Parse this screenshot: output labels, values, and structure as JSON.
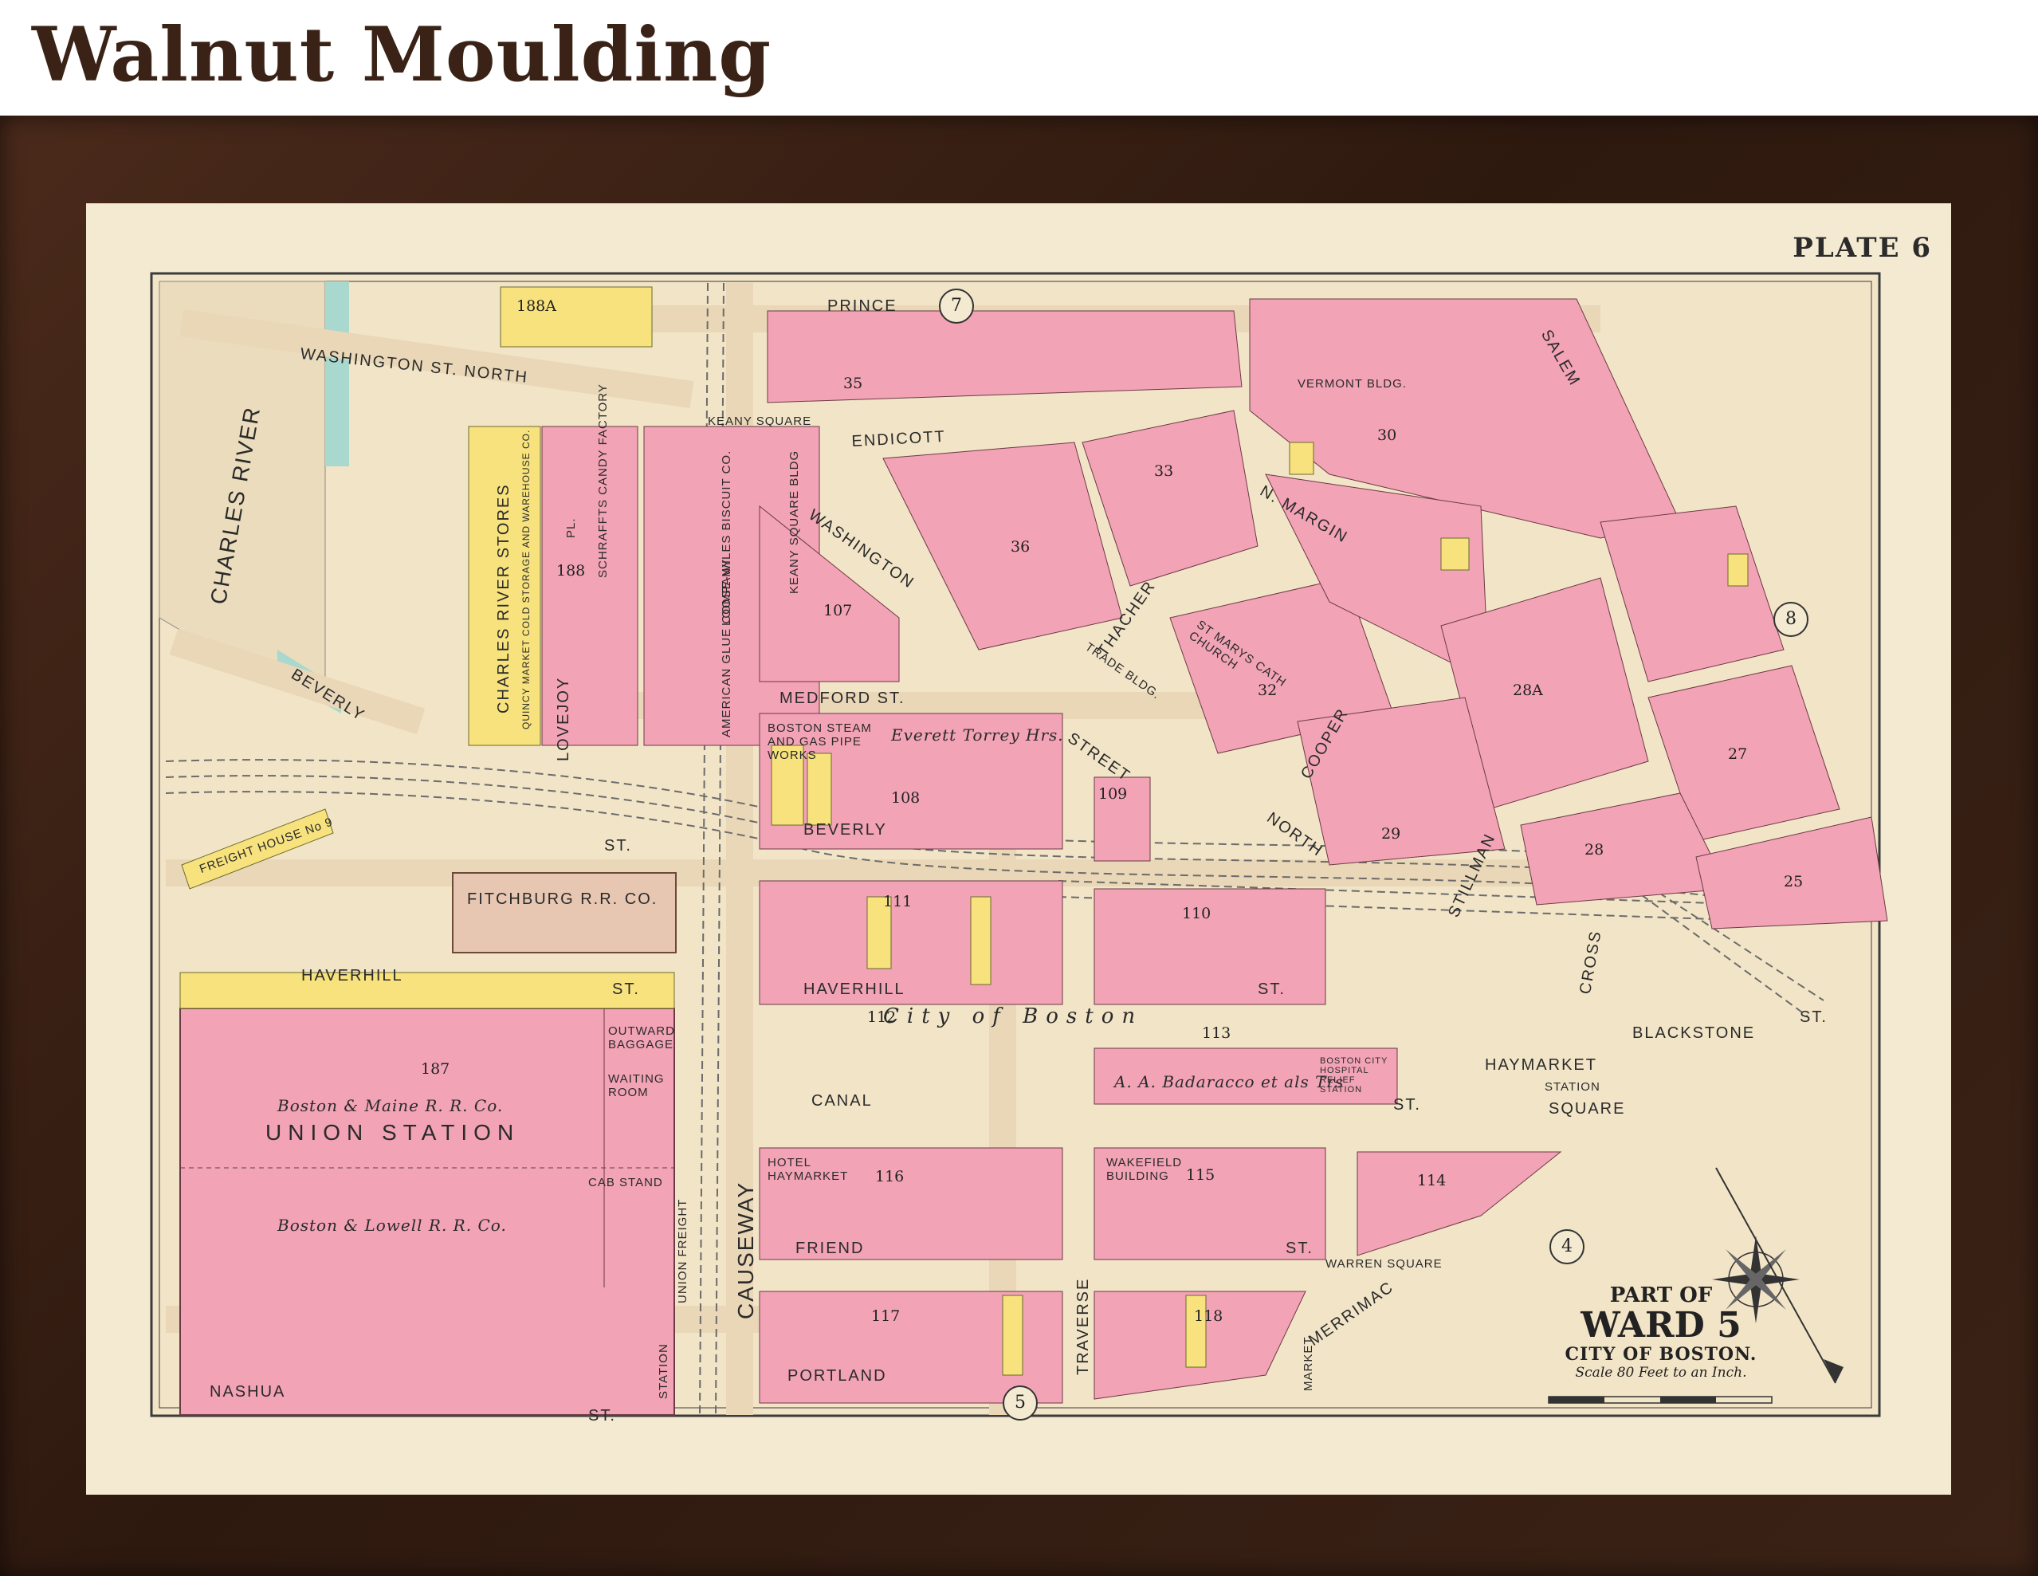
{
  "heading": "Walnut Moulding",
  "map": {
    "plate": "PLATE 6",
    "title": {
      "part_of": "PART OF",
      "ward": "WARD 5",
      "city": "CITY OF BOSTON.",
      "scale": "Scale 80 Feet to an Inch."
    },
    "ward_markers": [
      "7",
      "8",
      "4",
      "5"
    ],
    "streets": {
      "charles_river": "CHARLES RIVER",
      "washington_north": "WASHINGTON ST. NORTH",
      "prince": "PRINCE",
      "endicott": "ENDICOTT",
      "keany_square": "KEANY SQUARE",
      "washington": "WASHINGTON",
      "medford": "MEDFORD ST.",
      "beverly": "BEVERLY",
      "beverly_st": "ST.",
      "beverly_east": "BEVERLY",
      "haverhill_west": "HAVERHILL",
      "haverhill_west_st": "ST.",
      "haverhill": "HAVERHILL",
      "haverhill_st": "ST.",
      "city_of_boston": "City of Boston",
      "blackstone": "BLACKSTONE",
      "blackstone_st": "ST.",
      "haymarket": "HAYMARKET",
      "haymarket_station": "STATION",
      "haymarket_square": "SQUARE",
      "canal": "CANAL",
      "canal_st": "ST.",
      "friend": "FRIEND",
      "friend_st": "ST.",
      "warren_square": "WARREN SQUARE",
      "portland": "PORTLAND",
      "nashua": "NASHUA",
      "nashua_st": "ST.",
      "causeway": "CAUSEWAY",
      "traverse": "TRAVERSE",
      "merrimac": "MERRIMAC",
      "market": "MARKET",
      "cross": "CROSS",
      "stillman": "STILLMAN",
      "north": "NORTH",
      "north_street": "STREET",
      "cooper": "COOPER",
      "thacher": "THACHER",
      "n_margin": "N. MARGIN",
      "salem": "SALEM",
      "lovejoy": "LOVEJOY",
      "lovejoy_pl": "PL.",
      "union_freight": "UNION FREIGHT",
      "station": "STATION"
    },
    "buildings": {
      "union_station": "UNION STATION",
      "boston_maine": "Boston & Maine R. R. Co.",
      "boston_lowell": "Boston & Lowell R. R. Co.",
      "outward_baggage": "OUTWARD BAGGAGE",
      "waiting_room": "WAITING ROOM",
      "cab_stand": "CAB STAND",
      "fitchburg": "FITCHBURG R.R. CO.",
      "freight_house": "FREIGHT HOUSE No 9",
      "charles_river_stores": "CHARLES RIVER STORES",
      "schraffts": "SCHRAFFTS CANDY FACTORY",
      "loose_wiles": "LOOSE-WILES BISCUIT CO.",
      "american_glue": "AMERICAN GLUE COMPANY",
      "quincy_market": "QUINCY MARKET COLD STORAGE AND WAREHOUSE CO.",
      "keany_bldg": "KEANY SQUARE BLDG",
      "boston_steam": "BOSTON STEAM AND GAS PIPE WORKS",
      "everett_torrey": "Everett Torrey Hrs.",
      "st_marys": "ST MARYS CATH CHURCH",
      "vermont_bldg": "VERMONT BLDG.",
      "wakefield": "WAKEFIELD BUILDING",
      "hotel_haymarket": "HOTEL HAYMARKET",
      "relief_station": "BOSTON CITY HOSPITAL RELIEF STATION",
      "badaracco": "A. A. Badaracco et als Trs",
      "trade_bldg": "TRADE BLDG."
    },
    "blocks": [
      "188A",
      "188",
      "187",
      "35",
      "36",
      "33",
      "30",
      "107",
      "108",
      "109",
      "110",
      "111",
      "112",
      "113",
      "114",
      "115",
      "116",
      "117",
      "118",
      "29",
      "25",
      "27",
      "28",
      "32",
      "28A"
    ]
  }
}
